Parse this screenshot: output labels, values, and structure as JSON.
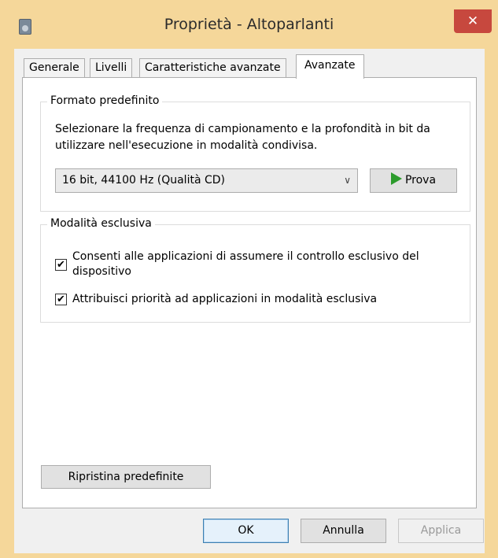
{
  "window": {
    "title": "Proprietà - Altoparlanti",
    "close_glyph": "✕"
  },
  "tabs": [
    {
      "label": "Generale"
    },
    {
      "label": "Livelli"
    },
    {
      "label": "Caratteristiche avanzate"
    },
    {
      "label": "Avanzate"
    }
  ],
  "default_format": {
    "legend": "Formato predefinito",
    "description": "Selezionare la frequenza di campionamento e la profondità in bit da utilizzare nell'esecuzione in modalità condivisa.",
    "selected_format": "16 bit, 44100 Hz (Qualità CD)",
    "test_button": "Prova"
  },
  "exclusive_mode": {
    "legend": "Modalità esclusiva",
    "options": [
      {
        "label": "Consenti alle applicazioni di assumere il controllo esclusivo del dispositivo",
        "checked": true
      },
      {
        "label": "Attribuisci priorità ad applicazioni in modalità esclusiva",
        "checked": true
      }
    ]
  },
  "restore_button": "Ripristina predefinite",
  "footer": {
    "ok": "OK",
    "cancel": "Annulla",
    "apply": "Applica"
  },
  "icons": {
    "checkmark": "✔",
    "chevron": "∨"
  }
}
